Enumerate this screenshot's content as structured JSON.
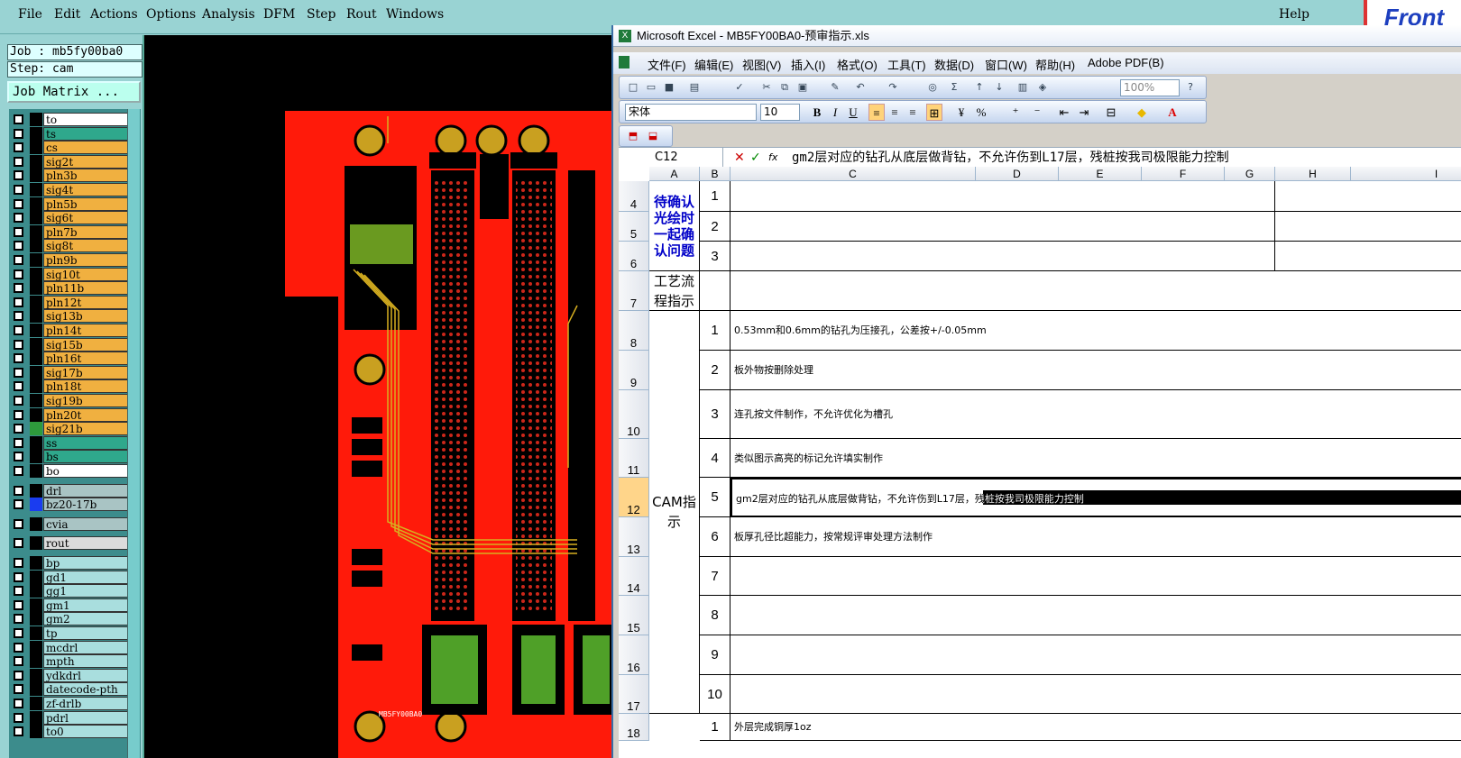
{
  "cam_menu": {
    "items": [
      "File",
      "Edit",
      "Actions",
      "Options",
      "Analysis",
      "DFM",
      "Step",
      "Rout",
      "Windows"
    ],
    "help": "Help",
    "logo": "Front"
  },
  "job_info": {
    "job": "Job : mb5fy00ba0",
    "step": "Step: cam",
    "matrix_button": "Job Matrix ..."
  },
  "layers": [
    {
      "name": "to",
      "color": "#000000",
      "bg": "#ffffff"
    },
    {
      "name": "ts",
      "color": "#000000",
      "bg": "#2fa88c"
    },
    {
      "name": "cs",
      "color": "#000000",
      "bg": "#f0b040"
    },
    {
      "name": "sig2t",
      "color": "#000000",
      "bg": "#f0b040"
    },
    {
      "name": "pln3b",
      "color": "#000000",
      "bg": "#f0b040"
    },
    {
      "name": "sig4t",
      "color": "#000000",
      "bg": "#f0b040"
    },
    {
      "name": "pln5b",
      "color": "#000000",
      "bg": "#f0b040"
    },
    {
      "name": "sig6t",
      "color": "#000000",
      "bg": "#f0b040"
    },
    {
      "name": "pln7b",
      "color": "#000000",
      "bg": "#f0b040"
    },
    {
      "name": "sig8t",
      "color": "#000000",
      "bg": "#f0b040"
    },
    {
      "name": "pln9b",
      "color": "#000000",
      "bg": "#f0b040"
    },
    {
      "name": "sig10t",
      "color": "#000000",
      "bg": "#f0b040"
    },
    {
      "name": "pln11b",
      "color": "#000000",
      "bg": "#f0b040"
    },
    {
      "name": "pln12t",
      "color": "#000000",
      "bg": "#f0b040"
    },
    {
      "name": "sig13b",
      "color": "#000000",
      "bg": "#f0b040"
    },
    {
      "name": "pln14t",
      "color": "#000000",
      "bg": "#f0b040"
    },
    {
      "name": "sig15b",
      "color": "#000000",
      "bg": "#f0b040"
    },
    {
      "name": "pln16t",
      "color": "#000000",
      "bg": "#f0b040"
    },
    {
      "name": "sig17b",
      "color": "#000000",
      "bg": "#f0b040"
    },
    {
      "name": "pln18t",
      "color": "#000000",
      "bg": "#f0b040"
    },
    {
      "name": "sig19b",
      "color": "#000000",
      "bg": "#f0b040"
    },
    {
      "name": "pln20t",
      "color": "#000000",
      "bg": "#f0b040"
    },
    {
      "name": "sig21b",
      "color": "#2e9a3c",
      "bg": "#f0b040"
    },
    {
      "name": "ss",
      "color": "#000000",
      "bg": "#2fa88c"
    },
    {
      "name": "bs",
      "color": "#000000",
      "bg": "#2fa88c"
    },
    {
      "name": "bo",
      "color": "#000000",
      "bg": "#ffffff"
    },
    {
      "name": "drl",
      "color": "#000000",
      "bg": "#a9c4c4"
    },
    {
      "name": "bz20-17b",
      "color": "#1a3cf0",
      "bg": "#a9c4c4"
    },
    {
      "name": "cvia",
      "color": "#000000",
      "bg": "#a9c4c4"
    },
    {
      "name": "rout",
      "color": "#000000",
      "bg": "#dcdcdc"
    },
    {
      "name": "bp",
      "color": "#000000",
      "bg": "#a9dede"
    },
    {
      "name": "gd1",
      "color": "#000000",
      "bg": "#a9dede"
    },
    {
      "name": "gg1",
      "color": "#000000",
      "bg": "#a9dede"
    },
    {
      "name": "gm1",
      "color": "#000000",
      "bg": "#a9dede"
    },
    {
      "name": "gm2",
      "color": "#000000",
      "bg": "#a9dede"
    },
    {
      "name": "tp",
      "color": "#000000",
      "bg": "#a9dede"
    },
    {
      "name": "mcdrl",
      "color": "#000000",
      "bg": "#a9dede"
    },
    {
      "name": "mpth",
      "color": "#000000",
      "bg": "#a9dede"
    },
    {
      "name": "ydkdrl",
      "color": "#000000",
      "bg": "#a9dede"
    },
    {
      "name": "datecode-pth",
      "color": "#000000",
      "bg": "#a9dede"
    },
    {
      "name": "zf-drlb",
      "color": "#000000",
      "bg": "#a9dede"
    },
    {
      "name": "pdrl",
      "color": "#000000",
      "bg": "#a9dede"
    },
    {
      "name": "to0",
      "color": "#000000",
      "bg": "#a9dede"
    }
  ],
  "layer_icon": "pencil-icon",
  "pcb_label": "MB5FY00BA0",
  "excel": {
    "title": "Microsoft Excel - MB5FY00BA0-预审指示.xls",
    "menu": [
      "文件(F)",
      "编辑(E)",
      "视图(V)",
      "插入(I)",
      "格式(O)",
      "工具(T)",
      "数据(D)",
      "窗口(W)",
      "帮助(H)",
      "Adobe PDF(B)"
    ],
    "zoom": "100%",
    "font_name": "宋体",
    "font_size": "10",
    "name_box": "C12",
    "formula": "gm2层对应的钻孔从底层做背钻，不允许伤到L17层，残桩按我司极限能力控制",
    "columns": [
      "A",
      "B",
      "C",
      "D",
      "E",
      "F",
      "G",
      "H",
      "I"
    ],
    "rows": [
      {
        "num": "4",
        "b": "1",
        "c": ""
      },
      {
        "num": "5",
        "b": "2",
        "c": ""
      },
      {
        "num": "6",
        "b": "3",
        "c": ""
      },
      {
        "num": "7",
        "b": "",
        "c": ""
      },
      {
        "num": "8",
        "b": "1",
        "c": "0.53mm和0.6mm的钻孔为压接孔，公差按+/-0.05mm"
      },
      {
        "num": "9",
        "b": "2",
        "c": "板外物按删除处理"
      },
      {
        "num": "10",
        "b": "3",
        "c": "连孔按文件制作，不允许优化为槽孔"
      },
      {
        "num": "11",
        "b": "4",
        "c": "类似图示高亮的标记允许填实制作"
      },
      {
        "num": "12",
        "b": "5",
        "c": "gm2层对应的钻孔从底层做背钻，不允许伤到L17层，残桩按我司极限能力控制"
      },
      {
        "num": "13",
        "b": "6",
        "c": "板厚孔径比超能力，按常规评审处理方法制作"
      },
      {
        "num": "14",
        "b": "7",
        "c": ""
      },
      {
        "num": "15",
        "b": "8",
        "c": ""
      },
      {
        "num": "16",
        "b": "9",
        "c": ""
      },
      {
        "num": "17",
        "b": "10",
        "c": ""
      },
      {
        "num": "18",
        "b": "1",
        "c": "外层完成铜厚1oz"
      }
    ],
    "group_pending": "待确认光绘时一起确认问题",
    "group_process": "工艺流程指示",
    "group_cam": "CAM指示"
  }
}
